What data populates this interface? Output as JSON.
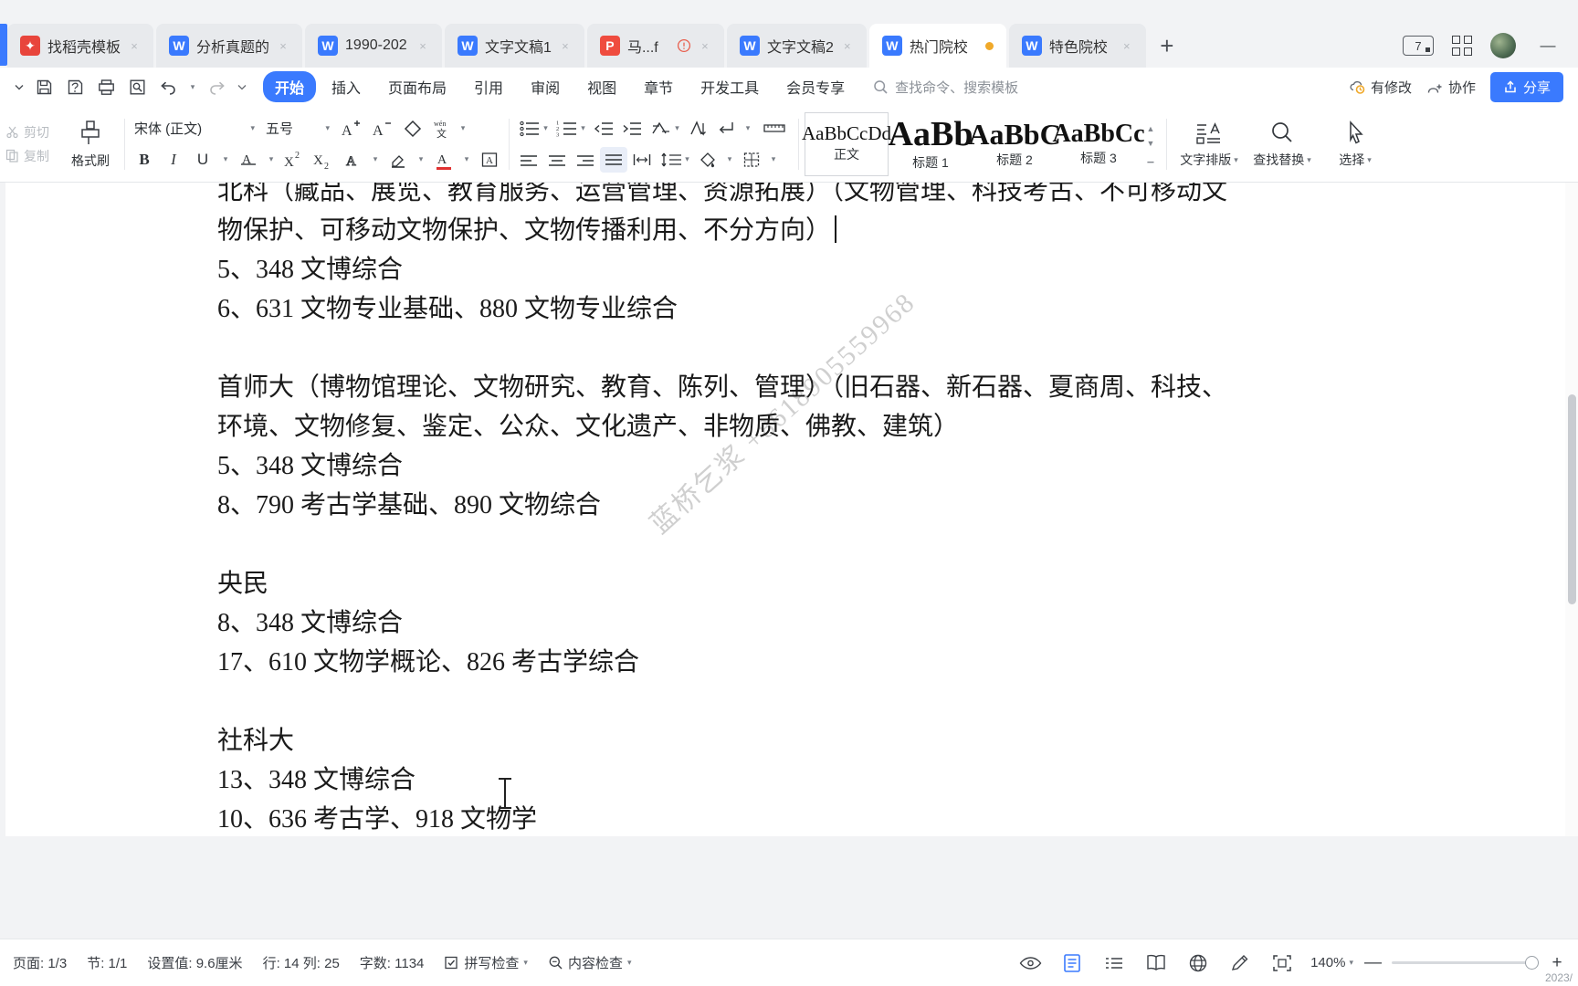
{
  "window": {
    "tab_count_badge": "7",
    "minimize": "—",
    "version_note": "2023/"
  },
  "tabs": [
    {
      "label": "找稻壳模板",
      "icon": "docer-icon",
      "kind": "docer",
      "active": false,
      "closable": true
    },
    {
      "label": "分析真题的",
      "icon": "wps-writer-icon",
      "kind": "w",
      "active": false,
      "closable": true
    },
    {
      "label": "1990-202",
      "icon": "wps-writer-icon",
      "kind": "w",
      "active": false,
      "closable": true
    },
    {
      "label": "文字文稿1",
      "icon": "wps-writer-icon",
      "kind": "w",
      "active": false,
      "closable": true
    },
    {
      "label": "马...f",
      "icon": "pdf-icon",
      "kind": "pdf",
      "active": false,
      "closable": true,
      "warning": true
    },
    {
      "label": "文字文稿2",
      "icon": "wps-writer-icon",
      "kind": "w",
      "active": false,
      "closable": true
    },
    {
      "label": "热门院校",
      "icon": "wps-writer-icon",
      "kind": "w",
      "active": true,
      "closable": false,
      "modified_dot": true
    },
    {
      "label": "特色院校",
      "icon": "wps-writer-icon",
      "kind": "w",
      "active": false,
      "closable": true
    }
  ],
  "menubar": {
    "items": [
      {
        "label": "开始",
        "active": true
      },
      {
        "label": "插入",
        "active": false
      },
      {
        "label": "页面布局",
        "active": false
      },
      {
        "label": "引用",
        "active": false
      },
      {
        "label": "审阅",
        "active": false
      },
      {
        "label": "视图",
        "active": false
      },
      {
        "label": "章节",
        "active": false
      },
      {
        "label": "开发工具",
        "active": false
      },
      {
        "label": "会员专享",
        "active": false
      }
    ],
    "search_placeholder": "查找命令、搜索模板",
    "sync_status": "有修改",
    "collaborate": "协作",
    "share": "分享"
  },
  "ribbon": {
    "cut": "剪切",
    "copy": "复制",
    "format_painter": "格式刷",
    "font_name": "宋体 (正文)",
    "font_size": "五号",
    "styles": [
      {
        "preview": "AaBbCcDd",
        "name": "正文",
        "selected": true,
        "size": 21
      },
      {
        "preview": "AaBb",
        "name": "标题 1",
        "selected": false,
        "size": 38
      },
      {
        "preview": "AaBbC",
        "name": "标题 2",
        "selected": false,
        "size": 32
      },
      {
        "preview": "AaBbCc",
        "name": "标题 3",
        "selected": false,
        "size": 28
      }
    ],
    "text_layout": "文字排版",
    "find_replace": "查找替换",
    "select": "选择"
  },
  "document": {
    "lines": [
      {
        "text": "北科（藏品、展览、教育服务、运营管理、资源拓展）（文物管理、科技考古、不可移动文",
        "clipped": true
      },
      {
        "text": "物保护、可移动文物保护、文物传播利用、不分方向）",
        "caret": true
      },
      {
        "text": "5、348 文博综合"
      },
      {
        "text": "6、631 文物专业基础、880 文物专业综合"
      },
      {
        "text": ""
      },
      {
        "text": "首师大（博物馆理论、文物研究、教育、陈列、管理）（旧石器、新石器、夏商周、科技、"
      },
      {
        "text": "环境、文物修复、鉴定、公众、文化遗产、非物质、佛教、建筑）"
      },
      {
        "text": "5、348 文博综合"
      },
      {
        "text": "8、790 考古学基础、890 文物综合"
      },
      {
        "text": ""
      },
      {
        "text": "央民"
      },
      {
        "text": "8、348 文博综合"
      },
      {
        "text": "17、610 文物学概论、826 考古学综合"
      },
      {
        "text": ""
      },
      {
        "text": "社科大"
      },
      {
        "text": "13、348 文博综合"
      },
      {
        "text": "10、636 考古学、918 文物学"
      }
    ],
    "watermark": "蓝桥乞浆 +8618905559968"
  },
  "statusbar": {
    "page": "页面: 1/3",
    "section": "节: 1/1",
    "setting": "设置值: 9.6厘米",
    "position": "行: 14 列: 25",
    "wordcount": "字数: 1134",
    "spellcheck": "拼写检查",
    "contentcheck": "内容检查",
    "zoom": "140%",
    "zoom_out": "—",
    "zoom_in": "+"
  },
  "colors": {
    "accent": "#3a7afe",
    "modified_dot": "#f0a92a",
    "underline_red": "#e03131"
  }
}
